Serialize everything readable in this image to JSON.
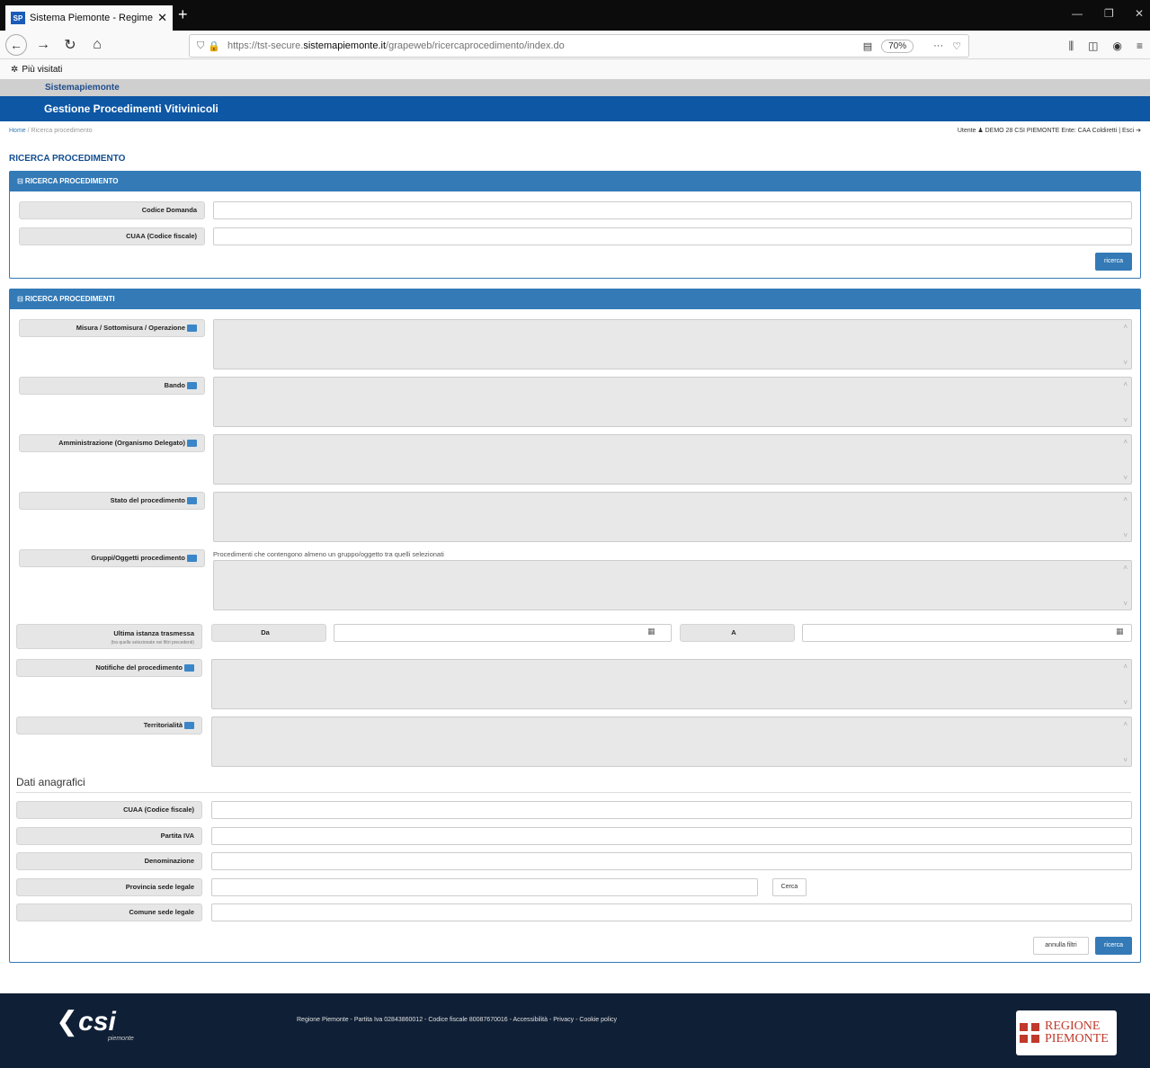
{
  "browser": {
    "tab_title": "Sistema Piemonte - Regime Pa",
    "tab_favicon": "SP",
    "url_prefix": "https://tst-secure.",
    "url_host": "sistemapiemonte.it",
    "url_path": "/grapeweb/ricercaprocedimento/index.do",
    "zoom": "70%",
    "bookmarks_item": "Più visitati"
  },
  "app": {
    "brand": "Sistemapiemonte",
    "title": "Gestione Procedimenti Vitivinicoli",
    "breadcrumb_home": "Home",
    "breadcrumb_current": "Ricerca procedimento",
    "user_info": "Utente ♟ DEMO 28 CSI PIEMONTE   Ente: CAA Coldiretti | Esci ➔"
  },
  "page_title": "RICERCA PROCEDIMENTO",
  "panel1": {
    "header": "⊟ RICERCA PROCEDIMENTO",
    "codice_domanda_label": "Codice Domanda",
    "cuaa_label": "CUAA (Codice fiscale)",
    "search_button": "ricerca"
  },
  "panel2": {
    "header": "⊟ RICERCA PROCEDIMENTI",
    "misura_label": "Misura / Sottomisura / Operazione",
    "bando_label": "Bando",
    "amministrazione_label": "Amministrazione (Organismo Delegato)",
    "stato_label": "Stato del procedimento",
    "gruppi_label": "Gruppi/Oggetti procedimento",
    "gruppi_note": "Procedimenti che contengono almeno un gruppo/oggetto tra quelli selezionati",
    "ultima_label": "Ultima istanza trasmessa",
    "ultima_sub": "(tra quelle selezionate nei filtri precedenti)",
    "da_label": "Da",
    "a_label": "A",
    "notifiche_label": "Notifiche del procedimento",
    "territorialita_label": "Territorialità",
    "anagrafica_heading": "Dati anagrafici",
    "cuaa_label": "CUAA (Codice fiscale)",
    "partita_iva_label": "Partita IVA",
    "denominazione_label": "Denominazione",
    "provincia_label": "Provincia sede legale",
    "cerca_button": "Cerca",
    "comune_label": "Comune sede legale",
    "annulla_button": "annulla filtri",
    "search_button": "ricerca"
  },
  "footer": {
    "text": "Regione Piemonte - Partita Iva 02843860012 - Codice fiscale 80087670016 - Accessibilità - Privacy - Cookie policy",
    "csi_logo": "csi",
    "csi_sub": "piemonte",
    "regione_line1": "REGIONE",
    "regione_line2": "PIEMONTE"
  },
  "icons": {
    "folder": "folder-icon",
    "calendar": "calendar-icon",
    "colors": {
      "primary": "#337ab7",
      "header": "#0d57a5",
      "footer": "#0f1f36"
    }
  }
}
